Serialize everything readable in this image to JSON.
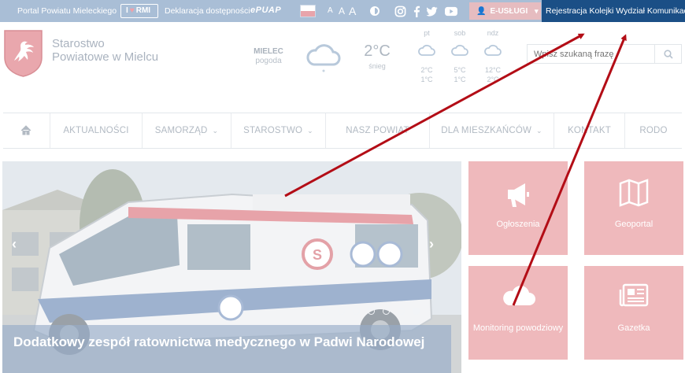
{
  "topbar": {
    "portal_link": "Portal Powiatu Mieleckiego",
    "rmi_prefix": "I",
    "rmi_label": "RMI",
    "accessibility_link": "Deklaracja dostępności",
    "epuap_label": "ePUAP",
    "font_small": "A",
    "font_medium": "A",
    "font_large": "A",
    "euslugi_label": "E-USŁUGI",
    "registration_link": "Rejestracja Kolejki Wydział Komunikacji"
  },
  "header": {
    "org_line1": "Starostwo",
    "org_line2": "Powiatowe w Mielcu"
  },
  "weather": {
    "city": "MIELEC",
    "city_sub": "pogoda",
    "temp": "2°C",
    "condition": "śnieg",
    "forecast": [
      {
        "day": "pt",
        "high": "2°C",
        "low": "1°C"
      },
      {
        "day": "sob",
        "high": "5°C",
        "low": "1°C"
      },
      {
        "day": "ndz",
        "high": "12°C",
        "low": "2°C"
      }
    ]
  },
  "search": {
    "placeholder": "Wpisz szukaną frazę"
  },
  "nav": {
    "items": [
      {
        "label": "AKTUALNOŚCI"
      },
      {
        "label": "SAMORZĄD"
      },
      {
        "label": "STAROSTWO"
      },
      {
        "label": "NASZ POWIAT"
      },
      {
        "label": "DLA MIESZKAŃCÓW"
      },
      {
        "label": "KONTAKT"
      },
      {
        "label": "RODO"
      }
    ]
  },
  "slider": {
    "caption": "Dodatkowy zespół ratownictwa medycznego w Padwi Narodowej",
    "prev_symbol": "‹",
    "next_symbol": "›",
    "dot_count": 7
  },
  "tiles": [
    {
      "label": "Ogłoszenia",
      "icon": "megaphone-icon"
    },
    {
      "label": "Geoportal",
      "icon": "map-icon"
    },
    {
      "label": "Monitoring powodziowy",
      "icon": "cloud-icon"
    },
    {
      "label": "Gazetka",
      "icon": "newspaper-icon"
    }
  ],
  "colors": {
    "topbar": "#a9bed6",
    "registration_bg": "#1b4f86",
    "euslugi_bg": "#e6bcc0",
    "tile_bg": "#efb9bc",
    "annotation_arrow": "#b30d16"
  }
}
